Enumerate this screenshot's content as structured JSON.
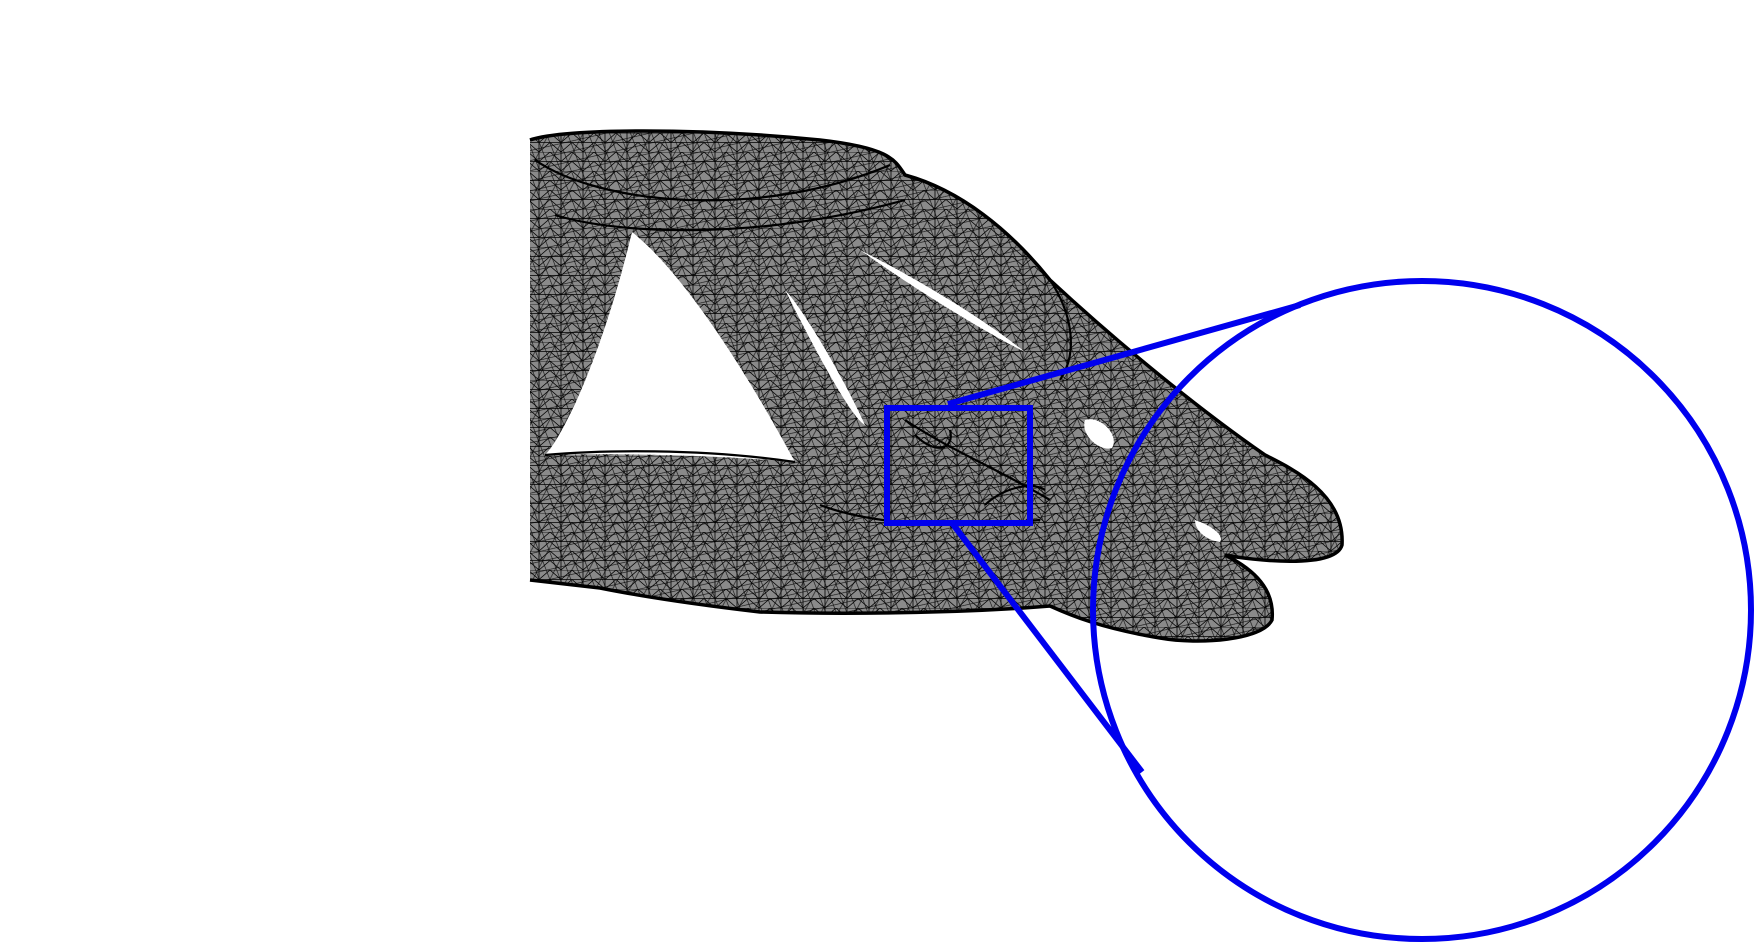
{
  "figure": {
    "background_color": "#ffffff",
    "mesh": {
      "fill_color": "#8a8a8a",
      "wire_color": "#000000",
      "description_hidden": true
    },
    "zoom_indicator": {
      "stroke_color": "#0000ee",
      "region_shape": "rectangle",
      "magnifier_shape": "circle",
      "magnifier_content": "empty"
    }
  }
}
